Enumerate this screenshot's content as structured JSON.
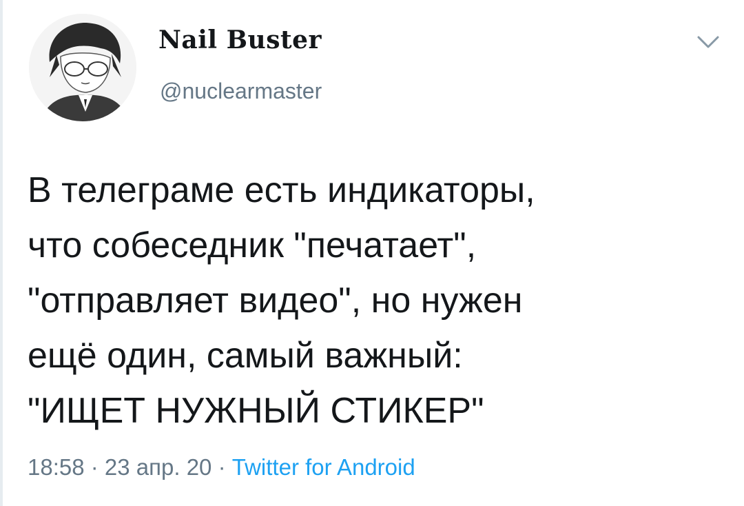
{
  "tweet": {
    "author": {
      "display_name": "Nail Buster",
      "handle": "@nuclearmaster"
    },
    "text_lines": [
      "В телеграме есть индикаторы,",
      "что собеседник \"печатает\",",
      "\"отправляет видео\", но нужен",
      "ещё один, самый важный:",
      "\"ИЩЕТ НУЖНЫЙ СТИКЕР\""
    ],
    "time": "18:58",
    "date": "23 апр. 20",
    "separator": " · ",
    "source": "Twitter for Android"
  },
  "icons": {
    "menu": "chevron-down-icon",
    "avatar": "anime-character-avatar"
  },
  "colors": {
    "text": "#14171a",
    "secondary": "#657786",
    "link": "#1da1f2"
  }
}
